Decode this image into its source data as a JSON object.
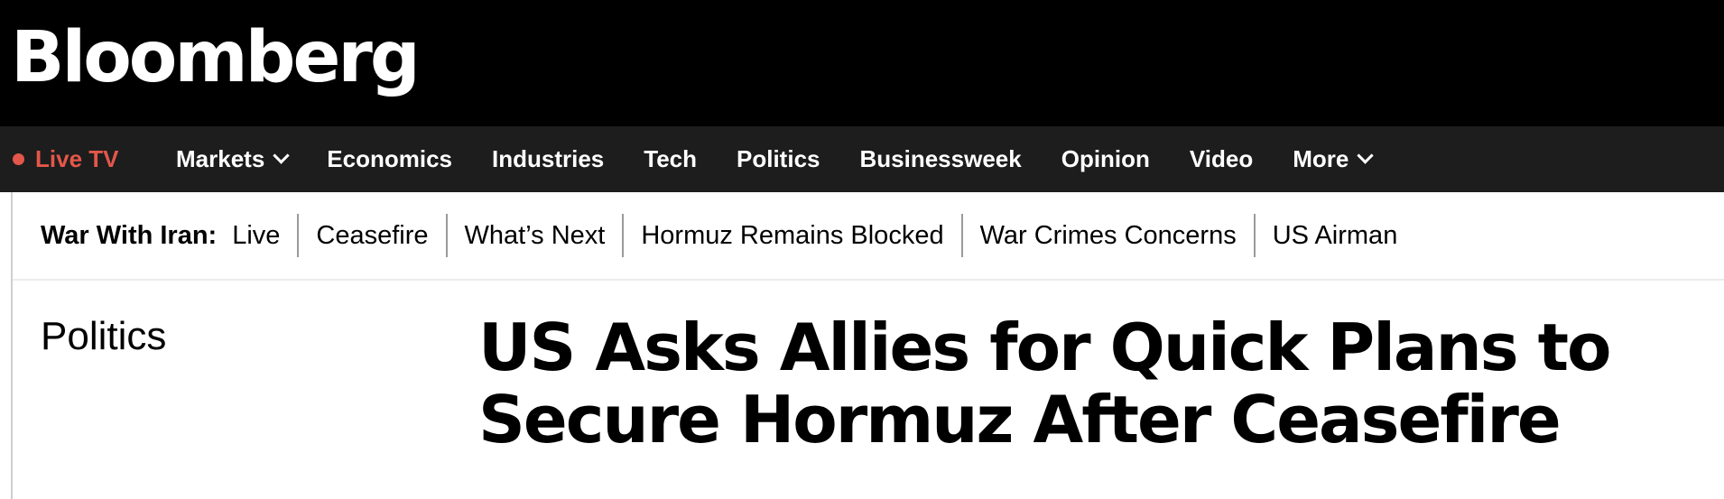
{
  "masthead": {
    "logo_text": "Bloomberg",
    "background": "#000000"
  },
  "nav": {
    "live_tv": "Live TV",
    "live_color": "#e3574a",
    "items": [
      {
        "label": "Markets",
        "dropdown": true
      },
      {
        "label": "Economics",
        "dropdown": false
      },
      {
        "label": "Industries",
        "dropdown": false
      },
      {
        "label": "Tech",
        "dropdown": false
      },
      {
        "label": "Politics",
        "dropdown": false
      },
      {
        "label": "Businessweek",
        "dropdown": false
      },
      {
        "label": "Opinion",
        "dropdown": false
      },
      {
        "label": "Video",
        "dropdown": false
      },
      {
        "label": "More",
        "dropdown": true
      }
    ],
    "background": "#1d1d1d"
  },
  "topic_bar": {
    "label": "War With Iran:",
    "links": [
      "Live",
      "Ceasefire",
      "What’s Next",
      "Hormuz Remains Blocked",
      "War Crimes Concerns",
      "US Airman"
    ]
  },
  "article": {
    "section": "Politics",
    "headline_line1": "US Asks Allies for Quick Plans to",
    "headline_line2": "Secure Hormuz After Ceasefire"
  }
}
